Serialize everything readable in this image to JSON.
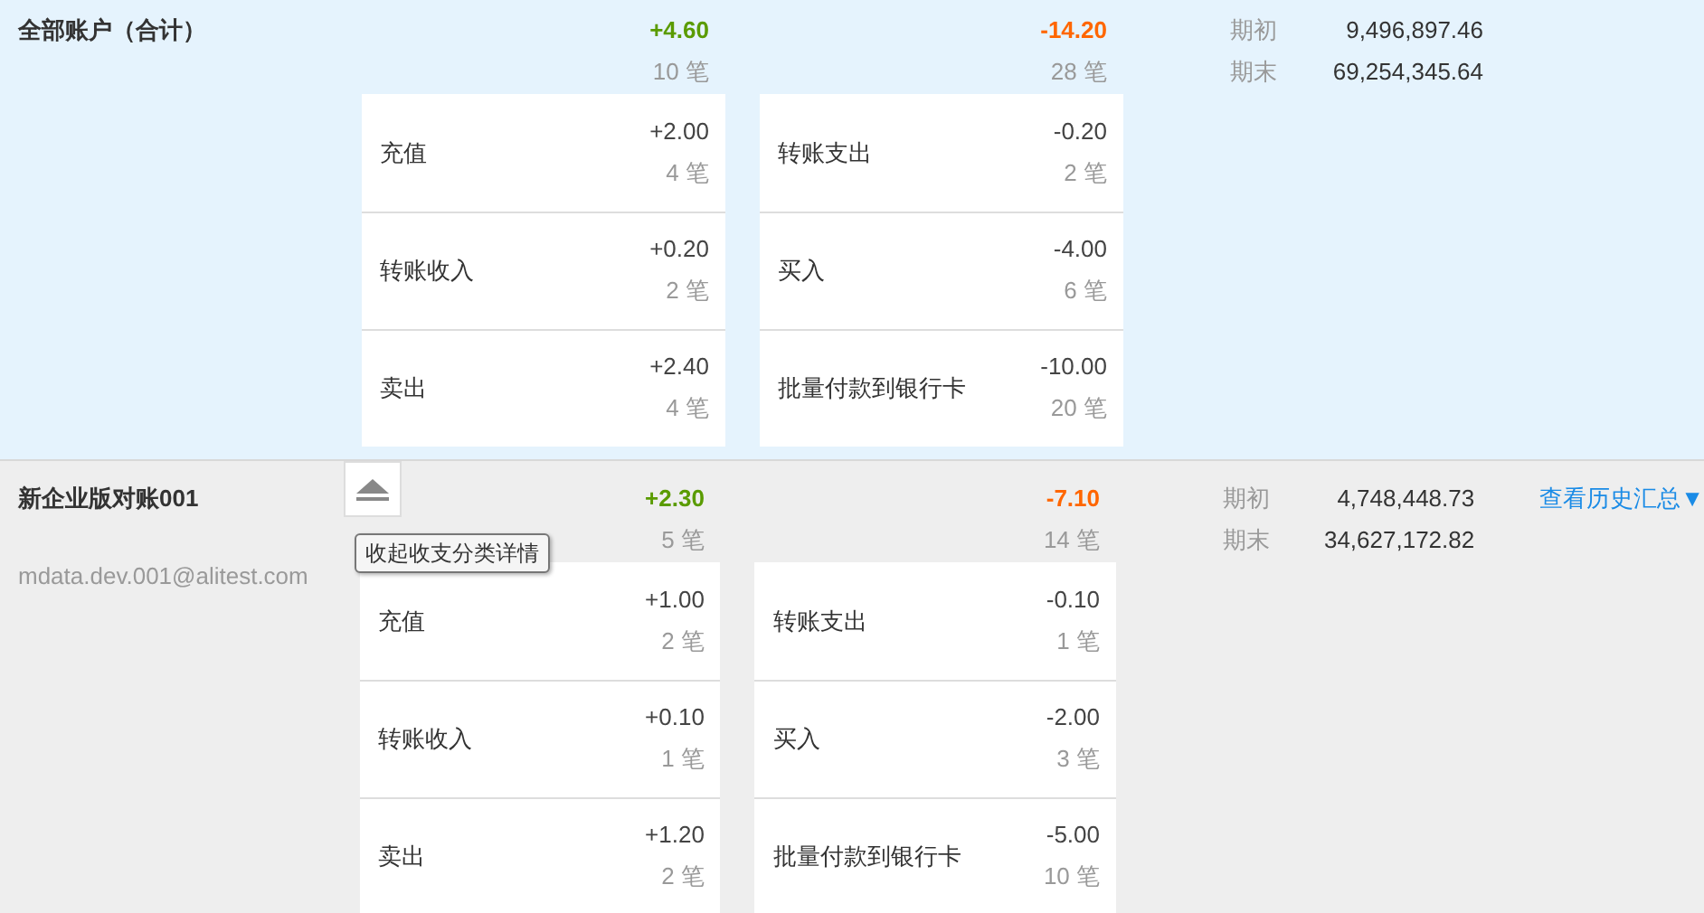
{
  "accounts": [
    {
      "kind": "total",
      "name": "全部账户（合计）",
      "income": {
        "total": "+4.60",
        "count": "10 笔",
        "items": [
          {
            "label": "充值",
            "amount": "+2.00",
            "count": "4 笔"
          },
          {
            "label": "转账收入",
            "amount": "+0.20",
            "count": "2 笔"
          },
          {
            "label": "卖出",
            "amount": "+2.40",
            "count": "4 笔"
          }
        ]
      },
      "expense": {
        "total": "-14.20",
        "count": "28 笔",
        "items": [
          {
            "label": "转账支出",
            "amount": "-0.20",
            "count": "2 笔"
          },
          {
            "label": "买入",
            "amount": "-4.00",
            "count": "6 笔"
          },
          {
            "label": "批量付款到银行卡",
            "amount": "-10.00",
            "count": "20 笔"
          }
        ]
      },
      "balances": [
        {
          "label": "期初",
          "value": "9,496,897.46"
        },
        {
          "label": "期末",
          "value": "69,254,345.64"
        }
      ]
    },
    {
      "kind": "account",
      "name": "新企业版对账001",
      "email": "mdata.dev.001@alitest.com",
      "tooltip": "收起收支分类详情",
      "link": "查看历史汇总▼",
      "income": {
        "total": "+2.30",
        "count": "5 笔",
        "items": [
          {
            "label": "充值",
            "amount": "+1.00",
            "count": "2 笔"
          },
          {
            "label": "转账收入",
            "amount": "+0.10",
            "count": "1 笔"
          },
          {
            "label": "卖出",
            "amount": "+1.20",
            "count": "2 笔"
          }
        ]
      },
      "expense": {
        "total": "-7.10",
        "count": "14 笔",
        "items": [
          {
            "label": "转账支出",
            "amount": "-0.10",
            "count": "1 笔"
          },
          {
            "label": "买入",
            "amount": "-2.00",
            "count": "3 笔"
          },
          {
            "label": "批量付款到银行卡",
            "amount": "-5.00",
            "count": "10 笔"
          }
        ]
      },
      "balances": [
        {
          "label": "期初",
          "value": "4,748,448.73"
        },
        {
          "label": "期末",
          "value": "34,627,172.82"
        }
      ]
    }
  ]
}
